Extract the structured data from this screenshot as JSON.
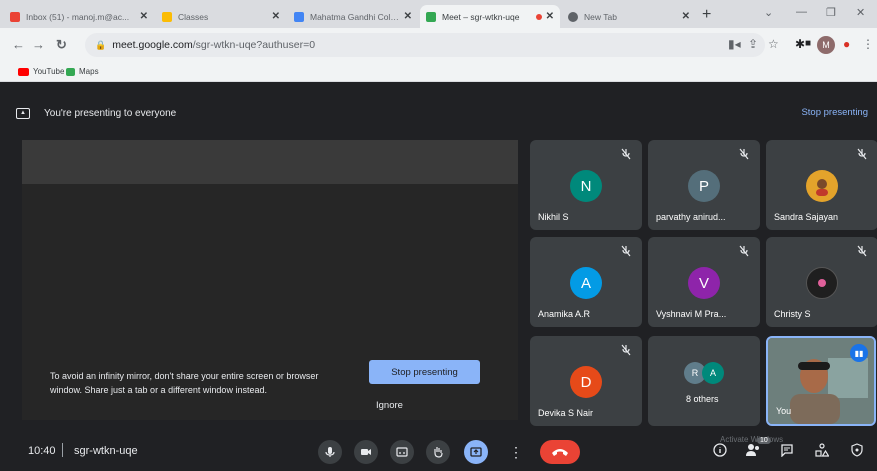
{
  "browser": {
    "tabs": [
      {
        "title": "Inbox (51) - manoj.m@ac...",
        "favicon_color": "#ea4335",
        "active": false
      },
      {
        "title": "Classes",
        "favicon_color": "#fbbc04",
        "active": false
      },
      {
        "title": "Mahatma Gandhi College...",
        "favicon_color": "#4285f4",
        "active": false
      },
      {
        "title": "Meet – sgr-wtkn-uqe",
        "favicon_color": "#34a853",
        "active": true
      },
      {
        "title": "New Tab",
        "favicon_color": "#5f6368",
        "active": false
      }
    ],
    "new_tab_symbol": "+",
    "url_host": "meet.google.com",
    "url_path": "/sgr-wtkn-uqe?authuser=0",
    "profile_initial": "M",
    "bookmarks": [
      {
        "label": "YouTube",
        "color": "#ff0000"
      },
      {
        "label": "Maps",
        "color": "#34a853"
      }
    ]
  },
  "meet": {
    "banner_text": "You're presenting to everyone",
    "stop_presenting_link": "Stop presenting",
    "infinity_message": "To avoid an infinity mirror, don't share your entire screen or browser window. Share just a tab or a different window instead.",
    "stop_presenting_button": "Stop presenting",
    "ignore_button": "Ignore",
    "participants": [
      {
        "name": "Nikhil S",
        "initial": "N",
        "color": "#00897b"
      },
      {
        "name": "parvathy anirud...",
        "initial": "P",
        "color": "#546e7a"
      },
      {
        "name": "Sandra Sajayan",
        "initial": "",
        "color": "#e3a32b"
      },
      {
        "name": "Anamika A.R",
        "initial": "A",
        "color": "#039be5"
      },
      {
        "name": "Vyshnavi M Pra...",
        "initial": "V",
        "color": "#8e24aa"
      },
      {
        "name": "Christy S",
        "initial": "",
        "color": "#1f1f1f"
      },
      {
        "name": "Devika S Nair",
        "initial": "D",
        "color": "#e64a19"
      }
    ],
    "others": {
      "label": "8 others",
      "initials": [
        "R",
        "A"
      ]
    },
    "self_label": "You",
    "clock": "10:40",
    "meeting_code": "sgr-wtkn-uqe",
    "people_count": "10",
    "watermark": "Activate Windows"
  }
}
